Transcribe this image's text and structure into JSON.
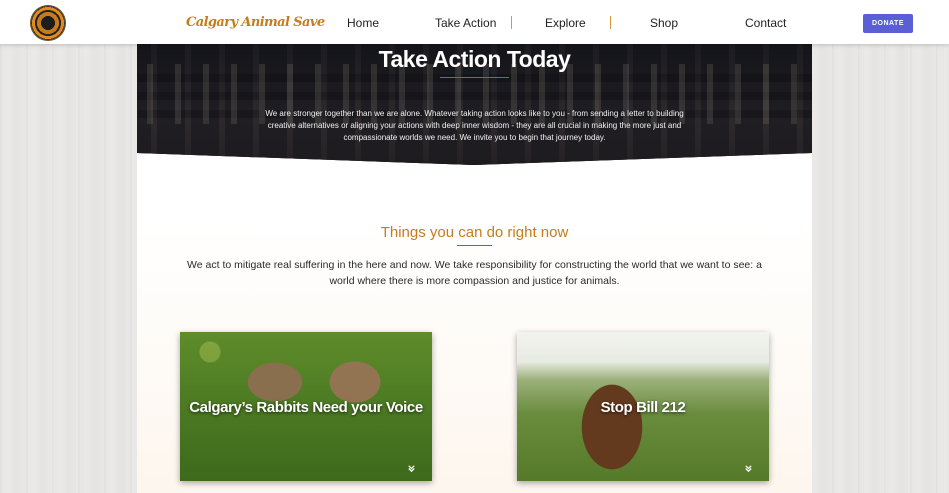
{
  "header": {
    "brand": "Calgary Animal Save",
    "nav": [
      "Home",
      "Take Action",
      "Explore",
      "Shop",
      "Contact"
    ],
    "donate_label": "DONATE"
  },
  "hero": {
    "title": "Take Action Today",
    "text": "We are stronger together than we are alone. Whatever taking action looks like to you - from sending a letter to building creative alternatives or aligning your actions with deep inner wisdom - they are all crucial in making the more just and compassionate worlds we need. We invite you to begin that journey today."
  },
  "section": {
    "title": "Things you can do right now",
    "text": "We act to mitigate real suffering in the here and now. We take responsibility for constructing the world that we want to see: a world where there is more compassion and justice for animals."
  },
  "cards": [
    {
      "title": "Calgary’s Rabbits Need your Voice",
      "chevron": "⌄"
    },
    {
      "title": "Stop Bill 212",
      "chevron": "⌄"
    }
  ],
  "colors": {
    "accent": "#c77b1d",
    "donate": "#5a5fd6",
    "underline": "#5a5fd6"
  },
  "icons": {
    "logo": "calgary-animal-save-logo",
    "card_chevron": "double-chevron-down-icon"
  }
}
